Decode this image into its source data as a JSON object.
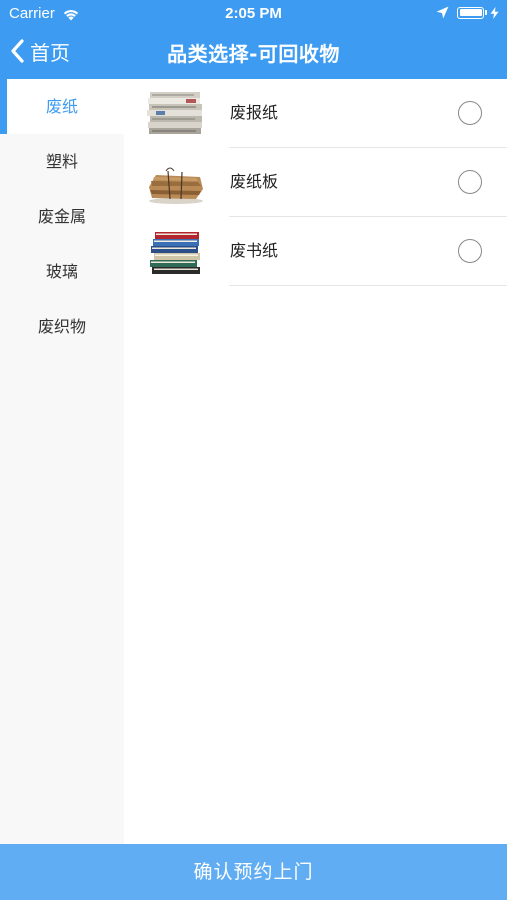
{
  "status_bar": {
    "carrier": "Carrier",
    "time": "2:05 PM",
    "icons": [
      "wifi-icon",
      "location-arrow-icon",
      "battery-icon",
      "charging-bolt-icon"
    ]
  },
  "nav": {
    "back_label": "首页",
    "title": "品类选择-可回收物"
  },
  "sidebar": {
    "items": [
      {
        "label": "废纸",
        "active": true
      },
      {
        "label": "塑料",
        "active": false
      },
      {
        "label": "废金属",
        "active": false
      },
      {
        "label": "玻璃",
        "active": false
      },
      {
        "label": "废织物",
        "active": false
      }
    ]
  },
  "items": [
    {
      "label": "废报纸",
      "image": "newspaper-stack",
      "selected": false
    },
    {
      "label": "废纸板",
      "image": "cardboard-bundle",
      "selected": false
    },
    {
      "label": "废书纸",
      "image": "book-stack",
      "selected": false
    }
  ],
  "confirm_button": {
    "label": "确认预约上门"
  },
  "colors": {
    "primary": "#3d9cf1",
    "button": "#61adf3",
    "sidebar_bg": "#f8f8f8",
    "divider": "#e6e6e6"
  }
}
